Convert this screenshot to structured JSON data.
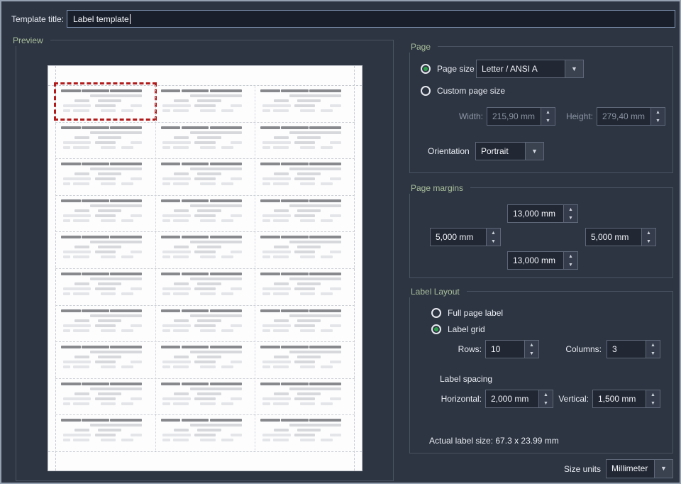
{
  "template_title": {
    "label": "Template title:",
    "value": "Label template"
  },
  "preview": {
    "title": "Preview",
    "grid": {
      "rows": 10,
      "columns": 3,
      "selected_cell": 0
    }
  },
  "page": {
    "title": "Page",
    "page_size": {
      "label": "Page size",
      "value": "Letter / ANSI A",
      "selected": true
    },
    "custom_page_size": {
      "label": "Custom page size",
      "selected": false
    },
    "width": {
      "label": "Width:",
      "value": "215,90 mm",
      "disabled": true
    },
    "height": {
      "label": "Height:",
      "value": "279,40 mm",
      "disabled": true
    },
    "orientation": {
      "label": "Orientation",
      "value": "Portrait"
    }
  },
  "page_margins": {
    "title": "Page margins",
    "top": "13,000 mm",
    "left": "5,000 mm",
    "right": "5,000 mm",
    "bottom": "13,000 mm"
  },
  "label_layout": {
    "title": "Label Layout",
    "full_page_label": {
      "label": "Full page label",
      "selected": false
    },
    "label_grid": {
      "label": "Label grid",
      "selected": true
    },
    "rows": {
      "label": "Rows:",
      "value": "10"
    },
    "columns": {
      "label": "Columns:",
      "value": "3"
    },
    "label_spacing_title": "Label spacing",
    "horizontal": {
      "label": "Horizontal:",
      "value": "2,000 mm"
    },
    "vertical": {
      "label": "Vertical:",
      "value": "1,500 mm"
    },
    "actual_label_size": "Actual label size: 67.3 x 23.99 mm"
  },
  "size_units": {
    "label": "Size units",
    "value": "Millimeter"
  },
  "icons": {
    "spin_up": "▲",
    "spin_down": "▼",
    "dropdown_arrow": "▼"
  },
  "colors": {
    "accent_green": "#2fa34c",
    "selection_red": "#b11a1a",
    "group_title_green": "#a9bf9b",
    "window_background": "#2d3542"
  }
}
